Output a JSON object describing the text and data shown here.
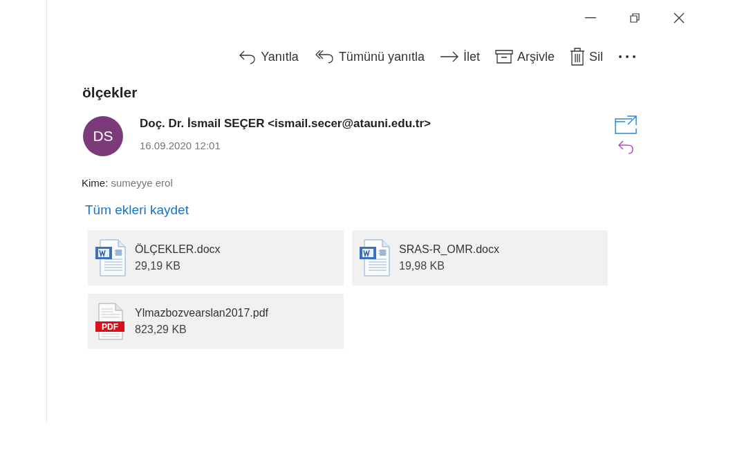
{
  "toolbar": [
    {
      "kind": "reply",
      "label": "Yanıtla"
    },
    {
      "kind": "reply-all",
      "label": "Tümünü yanıtla"
    },
    {
      "kind": "forward",
      "label": "İlet"
    },
    {
      "kind": "archive",
      "label": "Arşivle"
    },
    {
      "kind": "delete",
      "label": "Sil"
    },
    {
      "kind": "more"
    }
  ],
  "subject": "ölçekler",
  "sender": {
    "initials": "DS",
    "color": "#7b3a7a",
    "name": "Doç. Dr. İsmail SEÇER <ismail.secer@atauni.edu.tr>",
    "date": "16.09.2020 12:01"
  },
  "recipients": {
    "label": "Kime:",
    "value": "sumeyye erol"
  },
  "save_all": "Tüm ekleri kaydet",
  "attachments": [
    {
      "kind": "docx",
      "name": "ÖLÇEKLER.docx",
      "size": "29,19 KB"
    },
    {
      "kind": "docx",
      "name": "SRAS-R_OMR.docx",
      "size": "19,98 KB"
    },
    {
      "kind": "pdf",
      "name": "Ylmazbozvearslan2017.pdf",
      "size": "823,29 KB",
      "badge": "PDF"
    }
  ]
}
